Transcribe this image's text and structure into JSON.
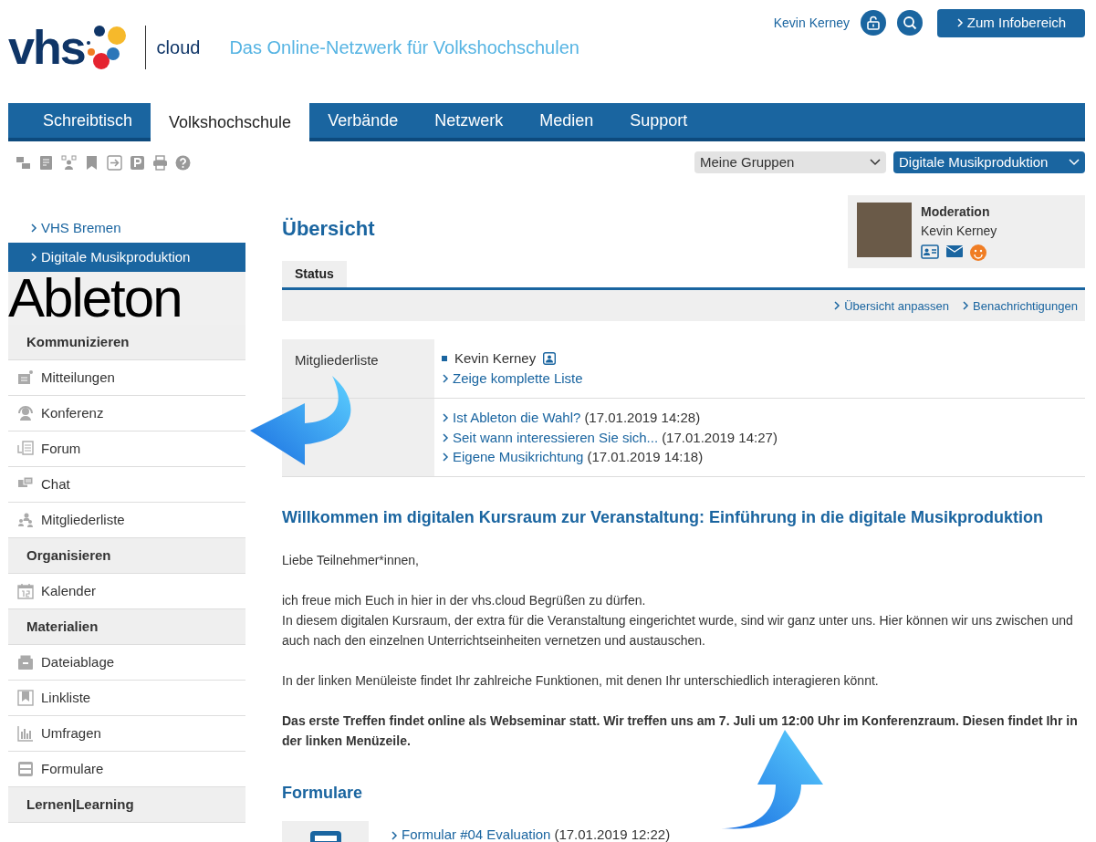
{
  "header": {
    "logo_text": "vhs",
    "logo_sub": "cloud",
    "tagline": "Das Online-Netzwerk für Volkshochschulen",
    "user_name": "Kevin Kerney",
    "info_button": "Zum Infobereich"
  },
  "nav_tabs": [
    {
      "label": "Schreibtisch",
      "selected": false
    },
    {
      "label": "Volkshochschule",
      "selected": true
    },
    {
      "label": "Verbände",
      "selected": false
    },
    {
      "label": "Netzwerk",
      "selected": false
    },
    {
      "label": "Medien",
      "selected": false
    },
    {
      "label": "Support",
      "selected": false
    }
  ],
  "selects": [
    {
      "value": "Meine Gruppen",
      "kind": "neutral"
    },
    {
      "value": "Digitale Musikproduktion",
      "kind": "primary"
    }
  ],
  "sidebar": {
    "breadcrumbs": [
      {
        "label": "VHS Bremen",
        "selected": false
      },
      {
        "label": "Digitale Musikproduktion",
        "selected": true
      }
    ],
    "banner_text": "Ableton",
    "sections": [
      {
        "title": "Kommunizieren",
        "items": [
          {
            "label": "Mitteilungen"
          },
          {
            "label": "Konferenz"
          },
          {
            "label": "Forum"
          },
          {
            "label": "Chat"
          },
          {
            "label": "Mitgliederliste"
          }
        ]
      },
      {
        "title": "Organisieren",
        "items": [
          {
            "label": "Kalender"
          }
        ]
      },
      {
        "title": "Materialien",
        "items": [
          {
            "label": "Dateiablage"
          },
          {
            "label": "Linkliste"
          },
          {
            "label": "Umfragen"
          },
          {
            "label": "Formulare"
          }
        ]
      },
      {
        "title": "Lernen|Learning"
      }
    ]
  },
  "main": {
    "title": "Übersicht",
    "tabs": [
      {
        "label": "Status",
        "selected": true
      }
    ],
    "actions": [
      "Übersicht anpassen",
      "Benachrichtigungen"
    ],
    "moderation": {
      "title": "Moderation",
      "name": "Kevin Kerney"
    },
    "rows": [
      {
        "kind": "members",
        "label": "Mitgliederliste",
        "members": [
          "Kevin Kerney"
        ],
        "link": "Zeige komplette Liste"
      },
      {
        "kind": "posts",
        "posts": [
          {
            "link": "Ist Ableton die Wahl?",
            "date": "(17.01.2019 14:28)"
          },
          {
            "link": "Seit wann interessieren Sie sich...",
            "date": "(17.01.2019 14:27)"
          },
          {
            "link": "Eigene Musikrichtung",
            "date": "(17.01.2019 14:18)"
          }
        ]
      }
    ],
    "welcome_title": "Willkommen im digitalen Kursraum zur Veranstaltung: Einführung in die digitale Musikproduktion",
    "paragraphs": [
      {
        "lines": [
          "Liebe Teilnehmer*innen,"
        ],
        "emphasis": false
      },
      {
        "lines": [
          "ich freue mich Euch in hier in der vhs.cloud Begrüßen zu dürfen.",
          "In diesem digitalen Kursraum, der extra für die Veranstaltung eingerichtet wurde, sind wir ganz unter uns. Hier können wir uns zwischen und auch nach den einzelnen Unterrichtseinheiten vernetzen und austauschen."
        ],
        "emphasis": false
      },
      {
        "lines": [
          "In der linken Menüleiste findet Ihr zahlreiche Funktionen, mit denen Ihr unterschiedlich interagieren könnt."
        ],
        "emphasis": false
      },
      {
        "lines": [
          "Das erste Treffen findet online als Webseminar statt. Wir treffen uns am 7. Juli um 12:00 Uhr im Konferenzraum. Diesen findet Ihr in der linken Menüzeile."
        ],
        "emphasis": true
      }
    ],
    "forms_title": "Formulare",
    "forms": [
      {
        "link": "Formular #04 Evaluation",
        "date": "(17.01.2019 12:22)"
      }
    ]
  }
}
